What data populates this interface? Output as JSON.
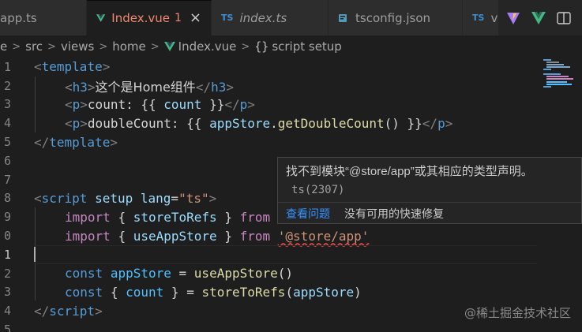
{
  "tabs": [
    {
      "label": "app.ts",
      "icon": "ts-icon",
      "italic": false
    },
    {
      "label": "Index.vue",
      "count": "1",
      "icon": "vue-icon",
      "active": true
    },
    {
      "label": "index.ts",
      "icon": "ts-icon",
      "italic": true
    },
    {
      "label": "tsconfig.json",
      "icon": "json-icon"
    },
    {
      "label": "v",
      "icon": "ts-icon"
    }
  ],
  "tab_icon_text": {
    "ts": "TS"
  },
  "breadcrumb": [
    "e",
    "src",
    "views",
    "home",
    "Index.vue",
    "script setup"
  ],
  "breadcrumb_brace": "{}",
  "line_numbers": [
    "1",
    "2",
    "3",
    "4",
    "5",
    "6",
    "7",
    "8",
    "9",
    "0",
    "1",
    "2",
    "3",
    "4",
    "5"
  ],
  "code": {
    "l1": {
      "open": "<",
      "tag": "template",
      "close": ">"
    },
    "l2": {
      "o1": "<",
      "t1": "h3",
      "c1": ">",
      "text": "这个是Home组件",
      "o2": "</",
      "t2": "h3",
      "c2": ">"
    },
    "l3": {
      "o1": "<",
      "t1": "p",
      "c1": ">",
      "text": "count: ",
      "m1": "{{",
      "var": "count",
      "m2": "}}",
      "o2": "</",
      "t2": "p",
      "c2": ">"
    },
    "l4": {
      "o1": "<",
      "t1": "p",
      "c1": ">",
      "text": "doubleCount: ",
      "m1": "{{",
      "obj": "appStore",
      "dot": ".",
      "fn": "getDoubleCount",
      "paren": "()",
      "m2": "}}",
      "o2": "</",
      "t2": "p",
      "c2": ">"
    },
    "l5": {
      "open": "</",
      "tag": "template",
      "close": ">"
    },
    "l8": {
      "open": "<",
      "tag": "script",
      "attr1": "setup",
      "attr2": "lang",
      "eq": "=",
      "val": "\"ts\"",
      "close": ">"
    },
    "l9": {
      "kw": "import",
      "b1": "{",
      "name": "storeToRefs",
      "b2": "}",
      "from": "from"
    },
    "l10": {
      "kw": "import",
      "b1": "{",
      "name": "useAppStore",
      "b2": "}",
      "from": "from",
      "str": "'@store/app'"
    },
    "l12": {
      "kw": "const",
      "name": "appStore",
      "eq": "=",
      "fn": "useAppStore",
      "paren": "()"
    },
    "l13": {
      "kw": "const",
      "b1": "{",
      "name": "count",
      "b2": "}",
      "eq": "=",
      "fn": "storeToRefs",
      "p1": "(",
      "arg": "appStore",
      "p2": ")"
    },
    "l14": {
      "open": "</",
      "tag": "script",
      "close": ">"
    }
  },
  "hover": {
    "message": "找不到模块“@store/app”或其相应的类型声明。",
    "code": "ts(2307)",
    "action_view": "查看问题",
    "action_fix": "没有可用的快速修复"
  },
  "watermark": "@稀土掘金技术社区",
  "colors": {
    "accent": "#3794ff",
    "error": "#f14c4c",
    "vue_green": "#42b883"
  }
}
